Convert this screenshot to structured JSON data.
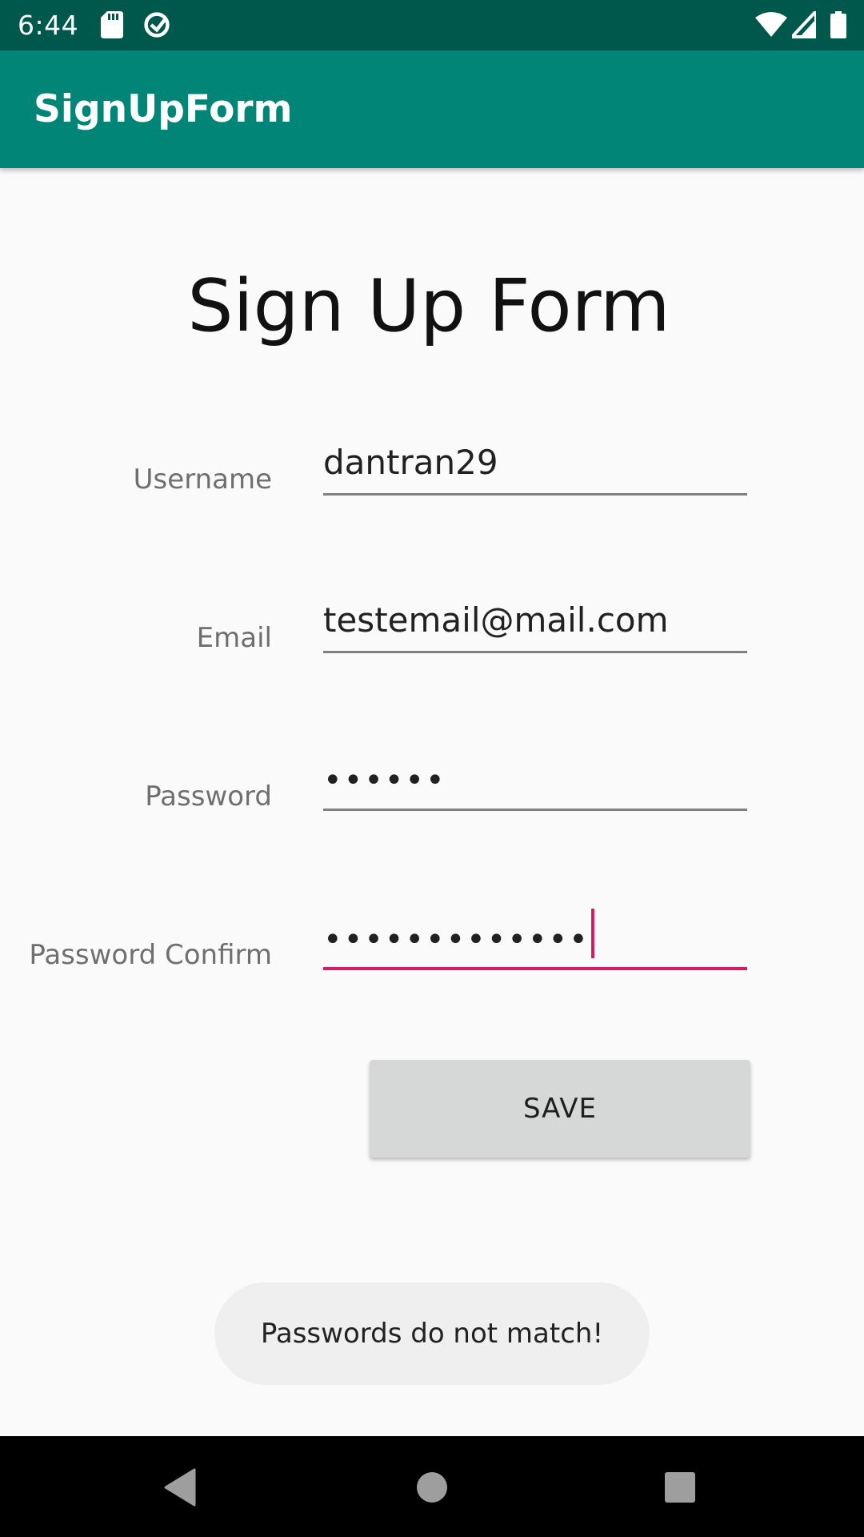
{
  "status_bar": {
    "time": "6:44",
    "icons": [
      "sd-card-icon",
      "sync-icon",
      "wifi-icon",
      "signal-icon",
      "battery-icon"
    ]
  },
  "app_bar": {
    "title": "SignUpForm",
    "color": "#008577"
  },
  "form": {
    "heading": "Sign Up Form",
    "fields": [
      {
        "label": "Username",
        "value": "dantran29"
      },
      {
        "label": "Email",
        "value": "testemail@mail.com"
      },
      {
        "label": "Password",
        "value": "••••••"
      },
      {
        "label": "Password Confirm",
        "value": "•••••••••••••"
      }
    ],
    "save_label": "SAVE",
    "accent": "#d81b60"
  },
  "toast": {
    "message": "Passwords do not match!"
  },
  "nav_bar": {
    "buttons": [
      "back-icon",
      "home-icon",
      "recents-icon"
    ]
  }
}
